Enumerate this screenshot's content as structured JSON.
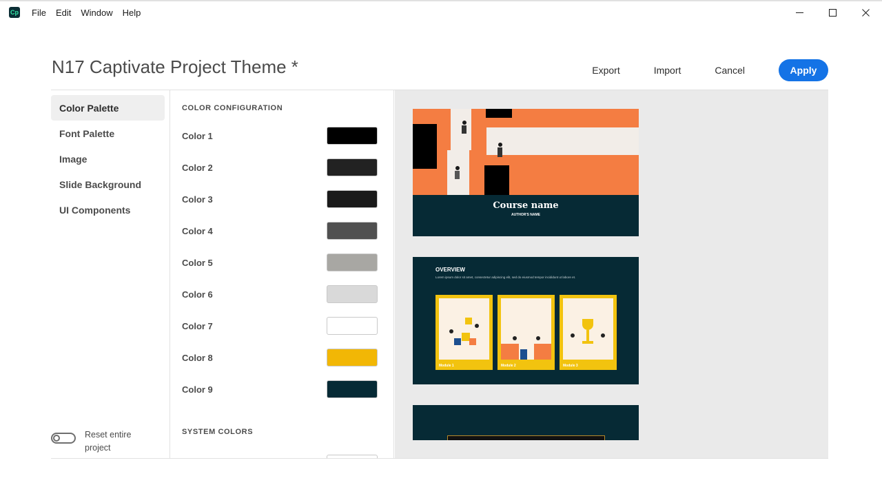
{
  "app": {
    "logo_text": "Cp"
  },
  "menu": [
    "File",
    "Edit",
    "Window",
    "Help"
  ],
  "window_controls": [
    "minimize-icon",
    "maximize-icon",
    "close-icon"
  ],
  "header": {
    "title": "N17 Captivate Project Theme  *",
    "actions": {
      "export": "Export",
      "import": "Import",
      "cancel": "Cancel",
      "apply": "Apply"
    }
  },
  "sidebar": {
    "items": [
      {
        "label": "Color Palette",
        "active": true
      },
      {
        "label": "Font Palette",
        "active": false
      },
      {
        "label": "Image",
        "active": false
      },
      {
        "label": "Slide Background",
        "active": false
      },
      {
        "label": "UI Components",
        "active": false
      }
    ],
    "reset_label": "Reset entire project",
    "reset_on": false
  },
  "config": {
    "section_title": "COLOR CONFIGURATION",
    "colors": [
      {
        "label": "Color 1",
        "value": "#000000"
      },
      {
        "label": "Color 2",
        "value": "#222222"
      },
      {
        "label": "Color 3",
        "value": "#1a1a1a"
      },
      {
        "label": "Color 4",
        "value": "#505050"
      },
      {
        "label": "Color 5",
        "value": "#a8a7a3"
      },
      {
        "label": "Color 6",
        "value": "#d9d9d9"
      },
      {
        "label": "Color 7",
        "value": "#ffffff"
      },
      {
        "label": "Color 8",
        "value": "#f2b705"
      },
      {
        "label": "Color 9",
        "value": "#062a35"
      }
    ],
    "system_title": "SYSTEM COLORS"
  },
  "preview": {
    "slide1": {
      "title": "Course name",
      "author": "AUTHOR'S NAME"
    },
    "slide2": {
      "heading": "OVERVIEW",
      "body": "Lorem ipsum dolor sit amet, consectetur adipiscing elit, sed do eiusmod tempor incididunt ut labore et.",
      "modules": [
        "Module 1",
        "Module 2",
        "Module 3"
      ]
    }
  }
}
